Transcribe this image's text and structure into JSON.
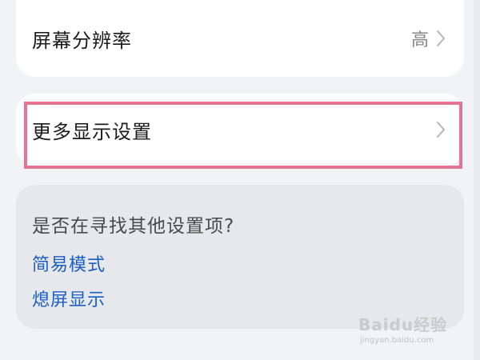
{
  "settings": {
    "resolution": {
      "label": "屏幕分辨率",
      "value": "高"
    },
    "more_display": {
      "label": "更多显示设置"
    }
  },
  "suggestions": {
    "title": "是否在寻找其他设置项?",
    "links": [
      "简易模式",
      "熄屏显示"
    ]
  },
  "watermark": {
    "logo_text": "Baidu经验",
    "sub_text": "jingyan.baidu.com"
  },
  "colors": {
    "background": "#f1f3f5",
    "card": "#ffffff",
    "link": "#1a5ec2",
    "highlight": "#e47394"
  },
  "icons": {
    "row_arrow": "chevron-right-icon"
  }
}
